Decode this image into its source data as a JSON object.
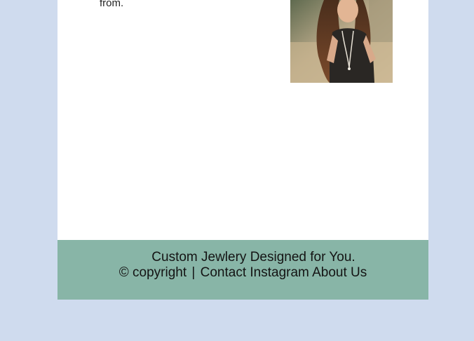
{
  "main": {
    "paragraph_tail": "from.",
    "photo": {
      "icon": "portrait-photo"
    }
  },
  "footer": {
    "tagline": "Custom Jewlery Designed for You.",
    "copyright_symbol": "©",
    "copyright_label": "copyright",
    "separator": "|",
    "links": {
      "contact": "Contact",
      "instagram": "Instagram",
      "about": "About Us"
    }
  },
  "colors": {
    "page_background": "#cfdbee",
    "content_background": "#ffffff",
    "footer_background": "#88b5a7"
  }
}
